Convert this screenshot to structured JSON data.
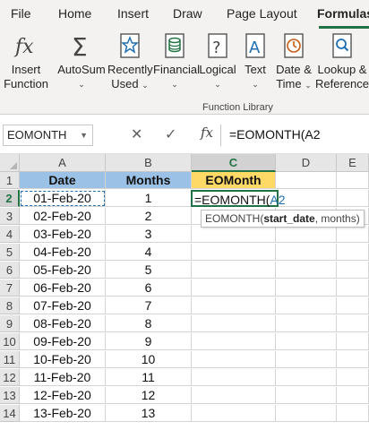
{
  "ribbon_tabs": [
    {
      "label": "File",
      "active": false
    },
    {
      "label": "Home",
      "active": false
    },
    {
      "label": "Insert",
      "active": false
    },
    {
      "label": "Draw",
      "active": false
    },
    {
      "label": "Page Layout",
      "active": false
    },
    {
      "label": "Formulas",
      "active": true
    }
  ],
  "ribbon": {
    "insert_function": {
      "line1": "Insert",
      "line2": "Function",
      "icon": "fx-icon"
    },
    "autosum": {
      "label": "AutoSum",
      "chevron": "⌄",
      "icon": "sigma-icon"
    },
    "recently_used": {
      "line1": "Recently",
      "line2": "Used",
      "chevron": "⌄",
      "icon": "star-icon"
    },
    "financial": {
      "label": "Financial",
      "chevron": "⌄",
      "icon": "coins-icon"
    },
    "logical": {
      "label": "Logical",
      "chevron": "⌄",
      "icon": "question-icon"
    },
    "text": {
      "label": "Text",
      "chevron": "⌄",
      "icon": "text-a-icon"
    },
    "date_time": {
      "line1": "Date &",
      "line2": "Time",
      "chevron": "⌄",
      "icon": "clock-icon"
    },
    "lookup": {
      "line1": "Lookup &",
      "line2": "Reference",
      "chevron": "⌄",
      "icon": "magnifier-icon"
    },
    "group_label": "Function Library",
    "accent_color": "#217346"
  },
  "formula_bar": {
    "name_box": "EOMONTH",
    "cancel_glyph": "✕",
    "enter_glyph": "✓",
    "fx_label": "fx",
    "formula": "=EOMONTH(A2"
  },
  "sheet": {
    "columns": [
      "A",
      "B",
      "C",
      "D",
      "E"
    ],
    "selected_column": "C",
    "selected_row": "2",
    "header_row": {
      "A": "Date",
      "B": "Months",
      "C": "EOMonth"
    },
    "rows": [
      {
        "n": "1"
      },
      {
        "n": "2",
        "date": "01-Feb-20",
        "months": "1"
      },
      {
        "n": "3",
        "date": "02-Feb-20",
        "months": "2"
      },
      {
        "n": "4",
        "date": "03-Feb-20",
        "months": "3"
      },
      {
        "n": "5",
        "date": "04-Feb-20",
        "months": "4"
      },
      {
        "n": "6",
        "date": "05-Feb-20",
        "months": "5"
      },
      {
        "n": "7",
        "date": "06-Feb-20",
        "months": "6"
      },
      {
        "n": "8",
        "date": "07-Feb-20",
        "months": "7"
      },
      {
        "n": "9",
        "date": "08-Feb-20",
        "months": "8"
      },
      {
        "n": "10",
        "date": "09-Feb-20",
        "months": "9"
      },
      {
        "n": "11",
        "date": "10-Feb-20",
        "months": "10"
      },
      {
        "n": "12",
        "date": "11-Feb-20",
        "months": "11"
      },
      {
        "n": "13",
        "date": "12-Feb-20",
        "months": "12"
      },
      {
        "n": "14",
        "date": "13-Feb-20",
        "months": "13"
      }
    ],
    "editing_cell": {
      "prefix": "=EOMONTH(",
      "ref": "A2"
    },
    "tooltip": {
      "fn": "EOMONTH(",
      "bold_arg": "start_date",
      "rest": ", months)"
    },
    "colors": {
      "header_blue": "#9bc2e6",
      "header_yellow": "#ffd966",
      "ref_blue": "#1f6fb2"
    }
  }
}
